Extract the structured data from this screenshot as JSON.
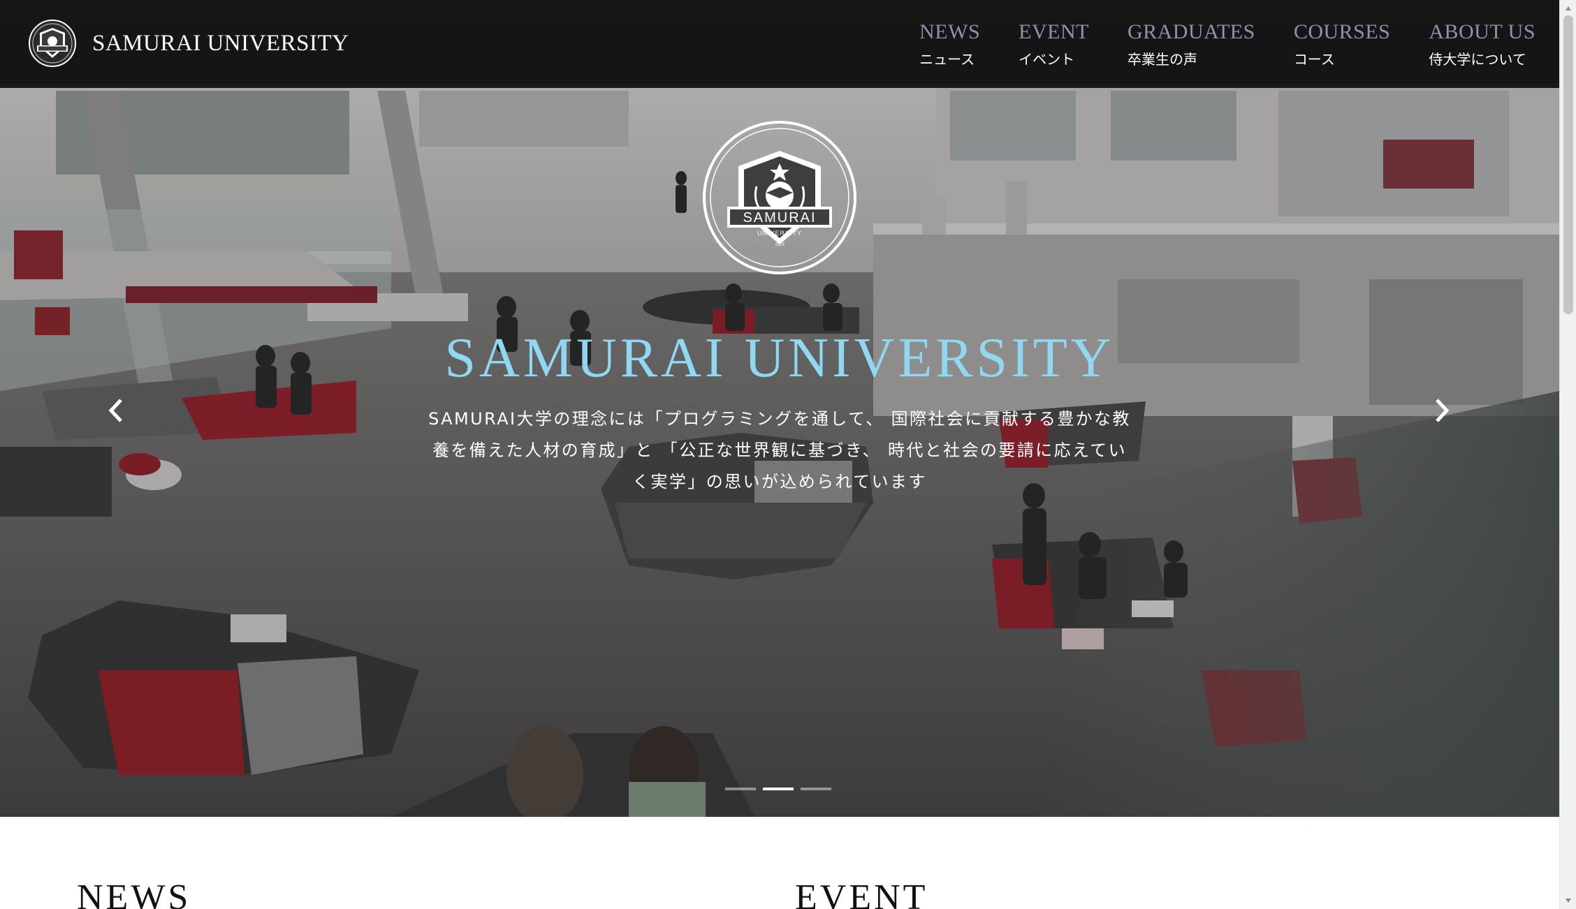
{
  "header": {
    "brand_name": "SAMURAI UNIVERSITY",
    "nav": [
      {
        "en": "NEWS",
        "ja": "ニュース"
      },
      {
        "en": "EVENT",
        "ja": "イベント"
      },
      {
        "en": "GRADUATES",
        "ja": "卒業生の声"
      },
      {
        "en": "COURSES",
        "ja": "コース"
      },
      {
        "en": "ABOUT US",
        "ja": "侍大学について"
      }
    ]
  },
  "hero": {
    "emblem_text": "SAMURAI",
    "emblem_subtext": "UNIVERSITY",
    "emblem_year": "1919",
    "title": "SAMURAI UNIVERSITY",
    "description": "SAMURAI大学の理念には「プログラミングを通して、 国際社会に貢献する豊かな教養を備えた人材の育成」と 「公正な世界観に基づき、 時代と社会の要請に応えていく実学」の思いが込められています",
    "slide_count": 3,
    "active_slide": 2
  },
  "sections": {
    "news_title": "NEWS",
    "event_title": "EVENT"
  },
  "colors": {
    "header_bg": "#0d0d0d",
    "nav_en": "#8d92ad",
    "hero_title": "#8fd8f2",
    "accent_red": "#a4202c"
  }
}
